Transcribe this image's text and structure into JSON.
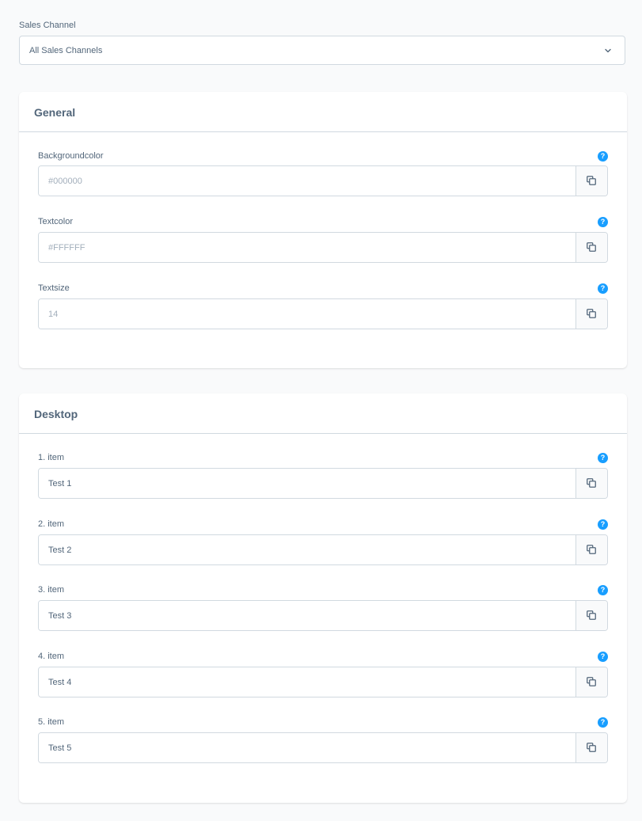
{
  "sales_channel": {
    "label": "Sales Channel",
    "selected": "All Sales Channels"
  },
  "general": {
    "title": "General",
    "fields": [
      {
        "label": "Backgroundcolor",
        "value": "",
        "placeholder": "#000000"
      },
      {
        "label": "Textcolor",
        "value": "",
        "placeholder": "#FFFFFF"
      },
      {
        "label": "Textsize",
        "value": "",
        "placeholder": "14"
      }
    ]
  },
  "desktop": {
    "title": "Desktop",
    "fields": [
      {
        "label": "1. item",
        "value": "Test 1",
        "placeholder": ""
      },
      {
        "label": "2. item",
        "value": "Test 2",
        "placeholder": ""
      },
      {
        "label": "3. item",
        "value": "Test 3",
        "placeholder": ""
      },
      {
        "label": "4. item",
        "value": "Test 4",
        "placeholder": ""
      },
      {
        "label": "5. item",
        "value": "Test 5",
        "placeholder": ""
      }
    ]
  },
  "help_glyph": "?",
  "icons": {
    "help": "help-circle-icon",
    "copy": "copy-icon",
    "select": "chevron-down-icon"
  },
  "colors": {
    "accent": "#189eff",
    "text": "#52667a",
    "placeholder": "#a2aebb",
    "border": "#d1d9e0",
    "page_bg": "#f9fafb"
  }
}
